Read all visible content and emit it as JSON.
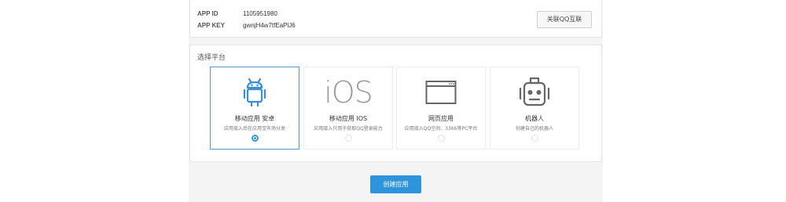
{
  "app_info": {
    "app_id_label": "APP ID",
    "app_id_value": "1105951980",
    "app_key_label": "APP KEY",
    "app_key_value": "gwnjH4w7tfEaPlJ6",
    "link_button": "关联QQ互联"
  },
  "platform": {
    "title": "选择平台",
    "selected_index": 0,
    "accent_color": "#3b95db",
    "cards": [
      {
        "icon": "android-icon",
        "name": "移动应用 安卓",
        "desc": "应用接入后在应用宝市场分发"
      },
      {
        "icon": "ios-icon",
        "icon_text": "iOS",
        "name": "移动应用 IOS",
        "desc": "应用接入只用于获取QQ登录能力"
      },
      {
        "icon": "browser-window-icon",
        "name": "网页应用",
        "desc": "应用接入QQ空间、3366等PC平台"
      },
      {
        "icon": "robot-icon",
        "name": "机器人",
        "desc": "创建自己的机器人"
      }
    ]
  },
  "create_button": "创建应用"
}
